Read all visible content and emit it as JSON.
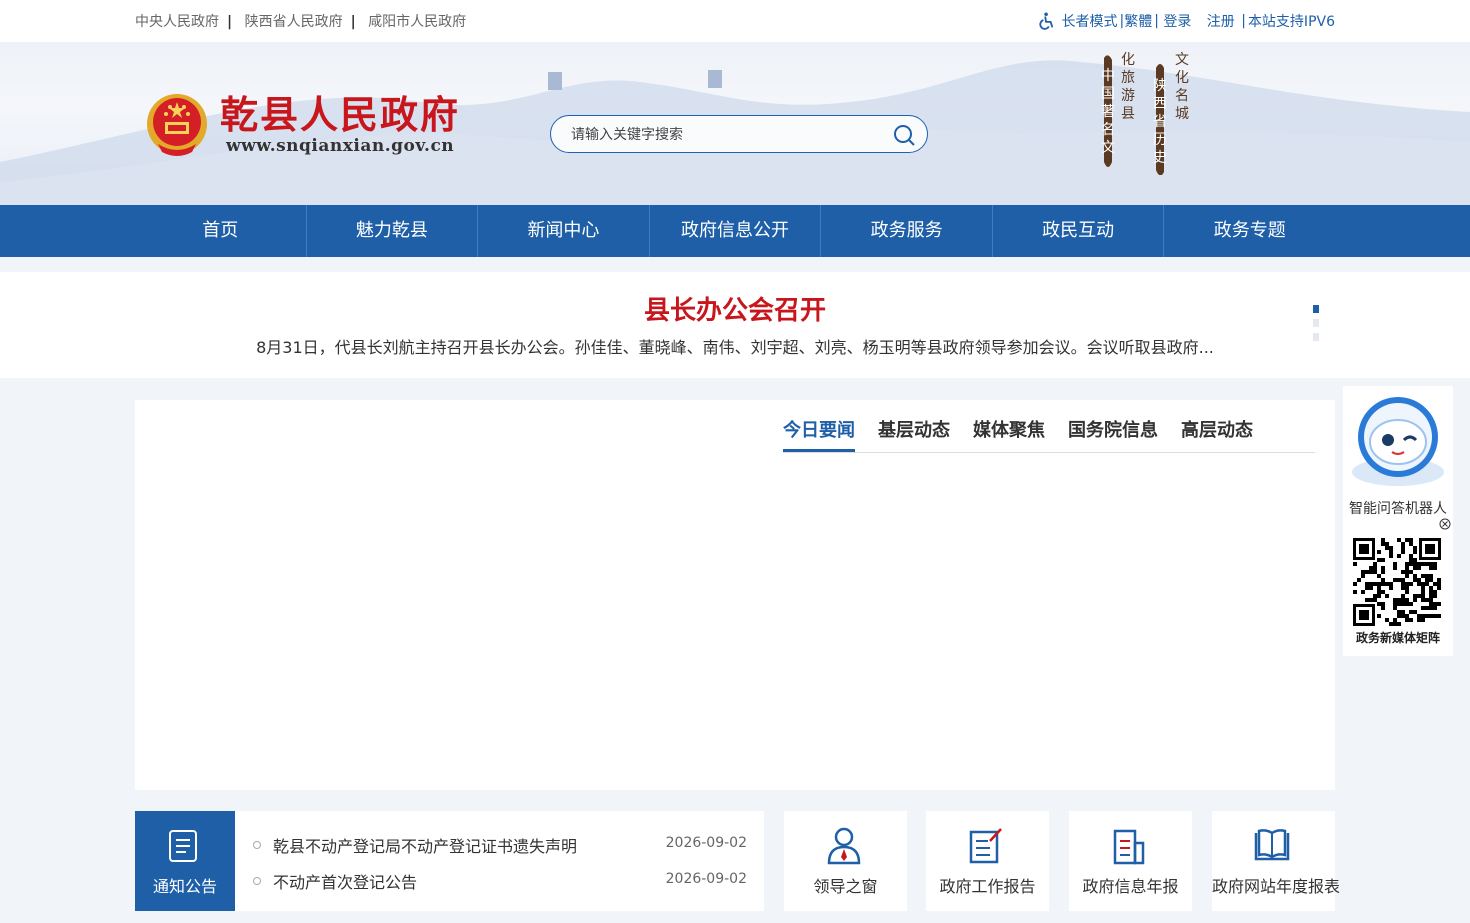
{
  "top_links": [
    "中央人民政府",
    "陕西省人民政府",
    "咸阳市人民政府"
  ],
  "top_right": {
    "elder_mode": "长者模式",
    "traditional": "繁體",
    "login": "登录",
    "register": "注册",
    "ipv6": "本站支持IPV6"
  },
  "logo": {
    "title": "乾县人民政府",
    "url": "www.snqianxian.gov.cn"
  },
  "search": {
    "placeholder": "请输入关键字搜索"
  },
  "calligraphy": [
    "中国著名文化旅游县",
    "陕西省历史文化名城"
  ],
  "nav": [
    "首页",
    "魅力乾县",
    "新闻中心",
    "政府信息公开",
    "政务服务",
    "政民互动",
    "政务专题"
  ],
  "headline": {
    "title": "县长办公会召开",
    "summary": "8月31日，代县长刘航主持召开县长办公会。孙佳佳、董晓峰、南伟、刘宇超、刘亮、杨玉明等县政府领导参加会议。会议听取县政府..."
  },
  "news_tabs": [
    "今日要闻",
    "基层动态",
    "媒体聚焦",
    "国务院信息",
    "高层动态"
  ],
  "robot": {
    "label": "智能问答机器人",
    "qr_label": "政务新媒体矩阵"
  },
  "notices": {
    "label": "通知公告",
    "items": [
      {
        "title": "乾县不动产登记局不动产登记证书遗失声明",
        "date": "2026-09-02"
      },
      {
        "title": "不动产首次登记公告",
        "date": "2026-09-02"
      }
    ]
  },
  "quick_links": [
    "领导之窗",
    "政府工作报告",
    "政府信息年报",
    "政府网站年度报表"
  ],
  "colors": {
    "primary": "#1e5fa8",
    "headline_red": "#c8161d"
  }
}
